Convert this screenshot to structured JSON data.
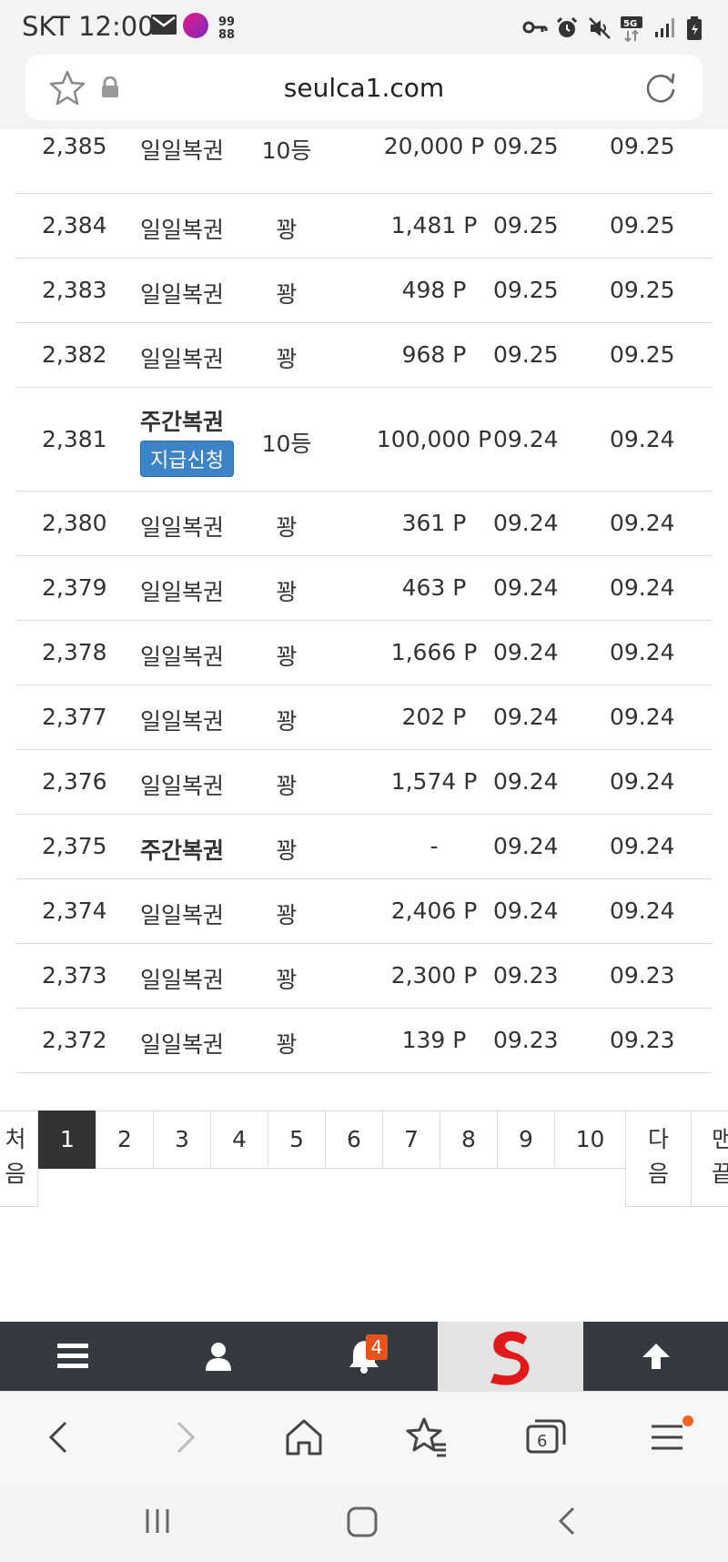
{
  "status_bar": {
    "carrier_time": "SKT 12:00",
    "network": "5G"
  },
  "address_bar": {
    "url": "seulca1.com"
  },
  "table": {
    "rows": [
      {
        "num": "2,385",
        "type": "일일복권",
        "rank": "10등",
        "point": "20,000 P",
        "date1": "09.25",
        "date2": "09.25"
      },
      {
        "num": "2,384",
        "type": "일일복권",
        "rank": "꽝",
        "point": "1,481 P",
        "date1": "09.25",
        "date2": "09.25"
      },
      {
        "num": "2,383",
        "type": "일일복권",
        "rank": "꽝",
        "point": "498 P",
        "date1": "09.25",
        "date2": "09.25"
      },
      {
        "num": "2,382",
        "type": "일일복권",
        "rank": "꽝",
        "point": "968 P",
        "date1": "09.25",
        "date2": "09.25"
      },
      {
        "num": "2,381",
        "type": "주간복권",
        "badge": "지급신청",
        "rank": "10등",
        "point": "100,000 P",
        "date1": "09.24",
        "date2": "09.24"
      },
      {
        "num": "2,380",
        "type": "일일복권",
        "rank": "꽝",
        "point": "361 P",
        "date1": "09.24",
        "date2": "09.24"
      },
      {
        "num": "2,379",
        "type": "일일복권",
        "rank": "꽝",
        "point": "463 P",
        "date1": "09.24",
        "date2": "09.24"
      },
      {
        "num": "2,378",
        "type": "일일복권",
        "rank": "꽝",
        "point": "1,666 P",
        "date1": "09.24",
        "date2": "09.24"
      },
      {
        "num": "2,377",
        "type": "일일복권",
        "rank": "꽝",
        "point": "202 P",
        "date1": "09.24",
        "date2": "09.24"
      },
      {
        "num": "2,376",
        "type": "일일복권",
        "rank": "꽝",
        "point": "1,574 P",
        "date1": "09.24",
        "date2": "09.24"
      },
      {
        "num": "2,375",
        "type": "주간복권",
        "rank": "꽝",
        "point": "-",
        "date1": "09.24",
        "date2": "09.24"
      },
      {
        "num": "2,374",
        "type": "일일복권",
        "rank": "꽝",
        "point": "2,406 P",
        "date1": "09.24",
        "date2": "09.24"
      },
      {
        "num": "2,373",
        "type": "일일복권",
        "rank": "꽝",
        "point": "2,300 P",
        "date1": "09.23",
        "date2": "09.23"
      },
      {
        "num": "2,372",
        "type": "일일복권",
        "rank": "꽝",
        "point": "139 P",
        "date1": "09.23",
        "date2": "09.23"
      }
    ]
  },
  "pagination": {
    "first": "처\n음",
    "pages": [
      "1",
      "2",
      "3",
      "4",
      "5",
      "6",
      "7",
      "8",
      "9",
      "10"
    ],
    "active_page": "1",
    "next": "다\n음",
    "last": "맨\n끝"
  },
  "site_nav": {
    "notification_count": "4"
  },
  "browser_toolbar": {
    "tab_count": "6"
  },
  "colors": {
    "nav_bg": "#343a40",
    "badge_blue": "#3d84c6",
    "notify_orange": "#e8521b",
    "active_page_bg": "#333333"
  }
}
